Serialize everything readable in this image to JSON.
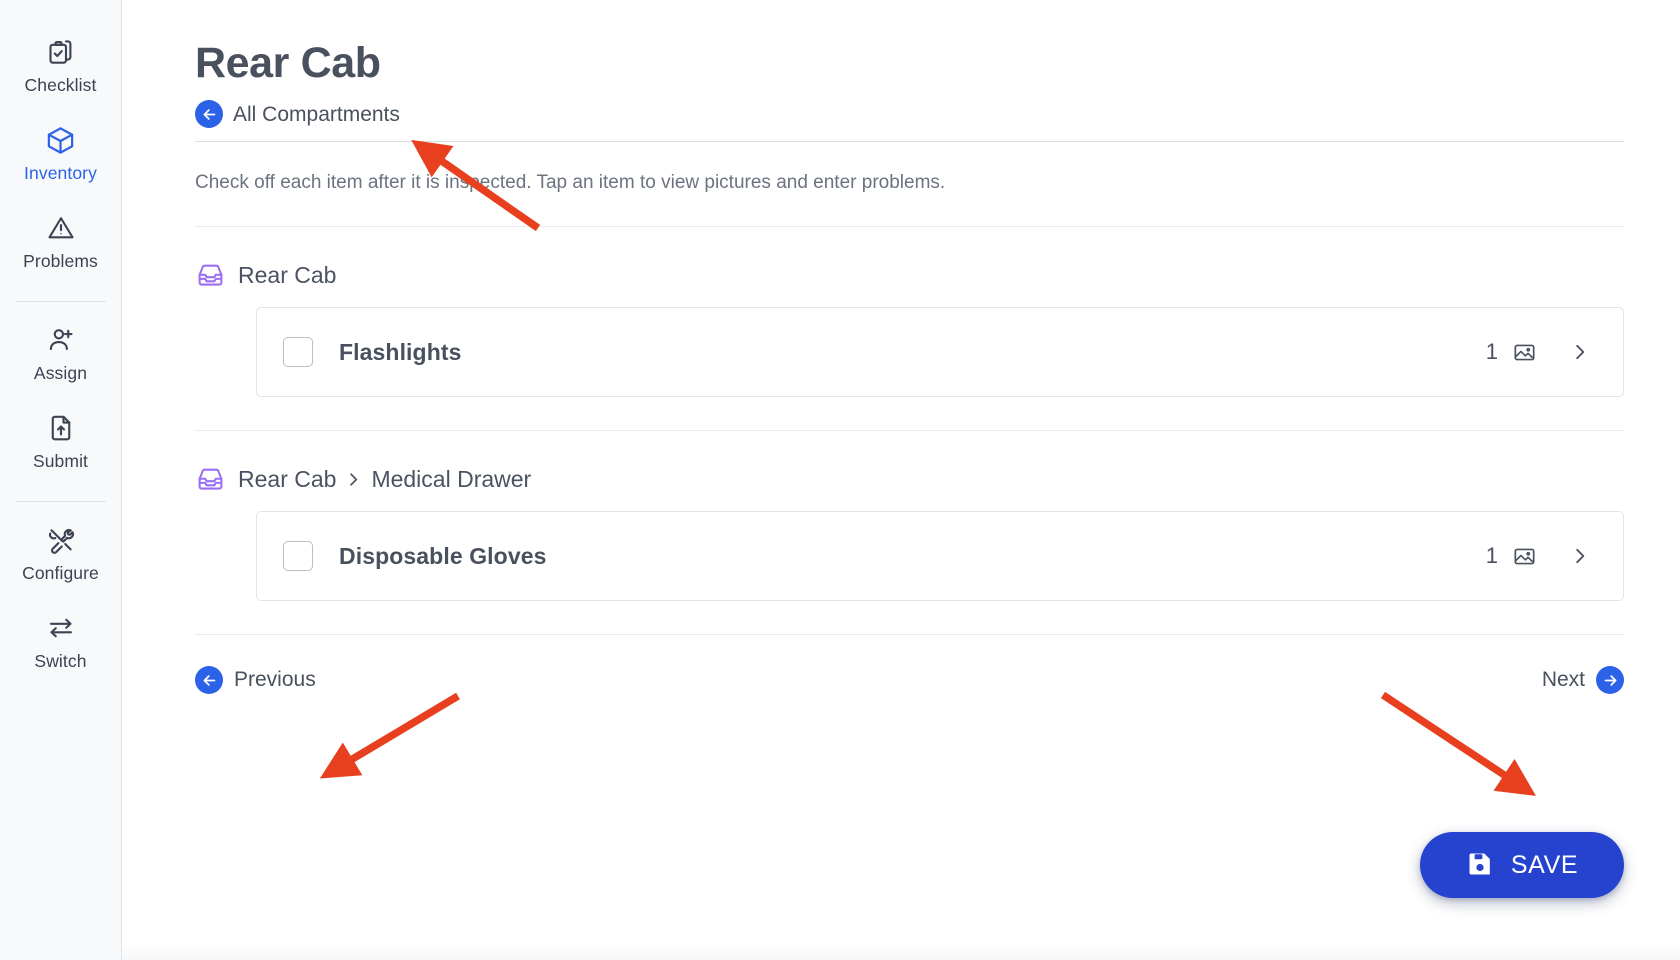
{
  "sidebar": {
    "items": [
      {
        "label": "Checklist",
        "icon": "clipboard-check-icon",
        "active": false
      },
      {
        "label": "Inventory",
        "icon": "cube-icon",
        "active": true
      },
      {
        "label": "Problems",
        "icon": "warning-triangle-icon",
        "active": false
      },
      {
        "label": "Assign",
        "icon": "user-plus-icon",
        "active": false
      },
      {
        "label": "Submit",
        "icon": "file-upload-icon",
        "active": false
      },
      {
        "label": "Configure",
        "icon": "tools-icon",
        "active": false
      },
      {
        "label": "Switch",
        "icon": "swap-arrows-icon",
        "active": false
      }
    ],
    "active_color": "#2b62e8",
    "idle_color": "#3c4453"
  },
  "header": {
    "title": "Rear Cab",
    "back_label": "All Compartments",
    "back_icon": "arrow-left-circle-icon"
  },
  "main": {
    "instructions": "Check off each item after it is inspected. Tap an item to view pictures and enter problems."
  },
  "groups": [
    {
      "icon": "drawers-icon",
      "path": [
        "Rear Cab"
      ],
      "items": [
        {
          "name": "Flashlights",
          "checked": false,
          "picture_count": "1",
          "picture_icon": "image-icon",
          "chevron_icon": "chevron-right-icon"
        }
      ]
    },
    {
      "icon": "drawers-icon",
      "path": [
        "Rear Cab",
        "Medical Drawer"
      ],
      "items": [
        {
          "name": "Disposable Gloves",
          "checked": false,
          "picture_count": "1",
          "picture_icon": "image-icon",
          "chevron_icon": "chevron-right-icon"
        }
      ]
    }
  ],
  "pager": {
    "previous_label": "Previous",
    "previous_icon": "arrow-left-circle-icon",
    "next_label": "Next",
    "next_icon": "arrow-right-circle-icon"
  },
  "save": {
    "label": "SAVE",
    "icon": "floppy-disk-icon",
    "color": "#2643cf"
  },
  "annotations": {
    "color": "#e8401f",
    "arrows": [
      {
        "target": "back-link"
      },
      {
        "target": "previous-button"
      },
      {
        "target": "next-button"
      }
    ]
  },
  "theme": {
    "accent": "#2b62e8",
    "drawer_icon_color": "#9b6ef3",
    "text": "#49515f",
    "muted": "#6b7280",
    "border": "#e2e5ea",
    "sidebar_bg": "#f8f9fb"
  }
}
